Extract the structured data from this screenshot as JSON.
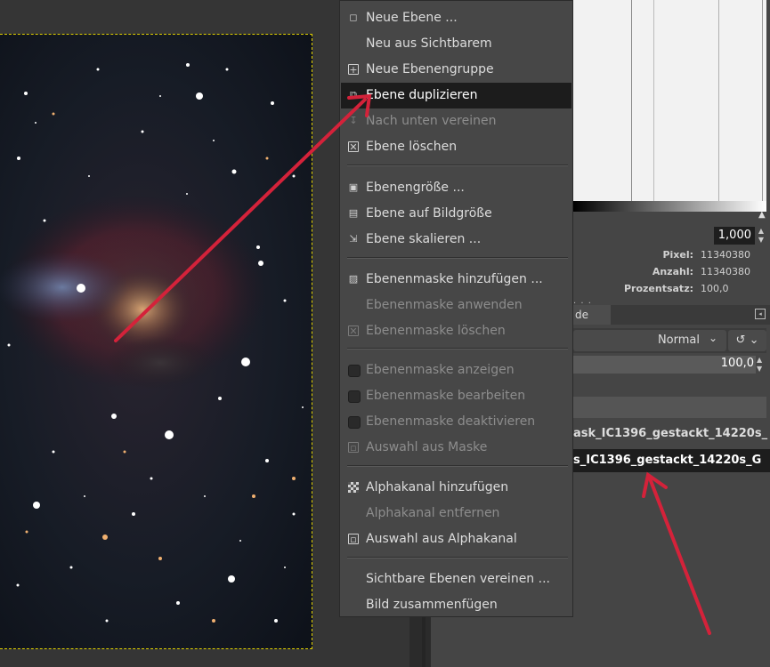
{
  "context_menu": {
    "items": [
      {
        "label": "Neue Ebene ...",
        "icon": "new-layer-icon",
        "disabled": false
      },
      {
        "label": "Neu aus Sichtbarem",
        "icon": "",
        "disabled": false
      },
      {
        "label": "Neue Ebenengruppe",
        "icon": "new-layer-group-icon",
        "disabled": false
      },
      {
        "label": "Ebene duplizieren",
        "icon": "duplicate-layer-icon",
        "disabled": false,
        "highlighted": true
      },
      {
        "label": "Nach unten vereinen",
        "icon": "merge-down-icon",
        "disabled": true
      },
      {
        "label": "Ebene löschen",
        "icon": "delete-layer-icon",
        "disabled": false
      },
      {
        "label": "Ebenengröße ...",
        "icon": "layer-boundary-size-icon",
        "disabled": false
      },
      {
        "label": "Ebene auf Bildgröße",
        "icon": "layer-to-image-size-icon",
        "disabled": false
      },
      {
        "label": "Ebene skalieren ...",
        "icon": "scale-layer-icon",
        "disabled": false
      },
      {
        "label": "Ebenenmaske hinzufügen ...",
        "icon": "add-layer-mask-icon",
        "disabled": false
      },
      {
        "label": "Ebenenmaske anwenden",
        "icon": "",
        "disabled": true
      },
      {
        "label": "Ebenenmaske löschen",
        "icon": "delete-layer-mask-icon",
        "disabled": true
      },
      {
        "label": "Ebenenmaske anzeigen",
        "icon": "checkbox-icon",
        "disabled": true
      },
      {
        "label": "Ebenenmaske bearbeiten",
        "icon": "checkbox-icon",
        "disabled": true
      },
      {
        "label": "Ebenenmaske deaktivieren",
        "icon": "checkbox-icon",
        "disabled": true
      },
      {
        "label": "Auswahl aus Maske",
        "icon": "selection-from-mask-icon",
        "disabled": true
      },
      {
        "label": "Alphakanal hinzufügen",
        "icon": "alpha-channel-icon",
        "disabled": false
      },
      {
        "label": "Alphakanal entfernen",
        "icon": "",
        "disabled": true
      },
      {
        "label": "Auswahl aus Alphakanal",
        "icon": "selection-from-alpha-icon",
        "disabled": false
      },
      {
        "label": "Sichtbare Ebenen vereinen ...",
        "icon": "",
        "disabled": false
      },
      {
        "label": "Bild zusammenfügen",
        "icon": "",
        "disabled": false
      }
    ]
  },
  "histogram": {
    "range_end": "1,000",
    "stats": [
      {
        "label": "Pixel:",
        "value": "11340380"
      },
      {
        "label": "Anzahl:",
        "value": "11340380"
      },
      {
        "label": "Prozentsatz:",
        "value": "100,0"
      }
    ]
  },
  "layers_panel": {
    "tab_label_fragment": "de",
    "mode": "Normal",
    "opacity": "100,0",
    "layers": [
      {
        "name": "ask_IC1396_gestackt_14220s_",
        "active": false
      },
      {
        "name": "s_IC1396_gestackt_14220s_G",
        "active": true
      }
    ]
  },
  "colors": {
    "annotation_arrow": "#d4223a",
    "menu_background": "#474747",
    "menu_highlight": "#1c1c1c",
    "selection_border": "#e0d000"
  }
}
